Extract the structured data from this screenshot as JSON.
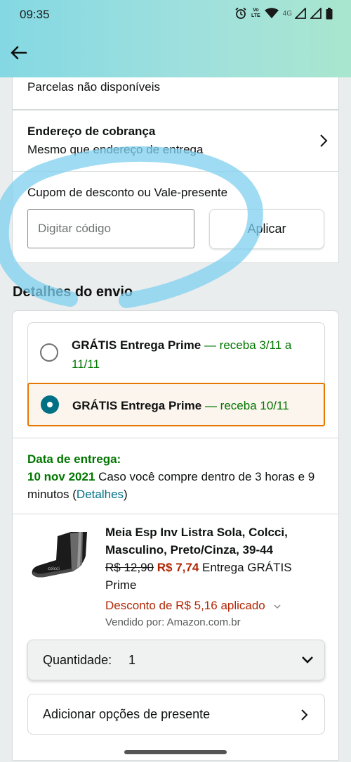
{
  "status": {
    "time": "09:35",
    "volte_line1": "Vo",
    "volte_line2": "LTE",
    "network": "4G"
  },
  "payment": {
    "installments": "Parcelas não disponíveis"
  },
  "billing": {
    "title": "Endereço de cobrança",
    "value": "Mesmo que endereço de entrega"
  },
  "coupon": {
    "label": "Cupom de desconto ou Vale-presente",
    "placeholder": "Digitar código",
    "apply": "Aplicar"
  },
  "shipping": {
    "title": "Detalhes do envio",
    "options": [
      {
        "name": "GRÁTIS Entrega Prime",
        "sep": " — ",
        "date": "receba 3/11 a 11/11",
        "selected": false
      },
      {
        "name": "GRÁTIS Entrega Prime",
        "sep": " — ",
        "date": "receba 10/11",
        "selected": true
      }
    ],
    "delivery_label": "Data de entrega:",
    "delivery_date": "10 nov 2021",
    "delivery_condition": " Caso você compre dentro de 3 horas e 9 minutos (",
    "details_link": "Detalhes",
    "close_paren": ")"
  },
  "product": {
    "name": "Meia Esp Inv Listra Sola, Colcci, Masculino, Preto/Cinza, 39-44",
    "old_price": "R$ 12,90",
    "price": "R$ 7,74",
    "shipping": " Entrega GRÁTIS Prime",
    "discount": "Desconto de R$ 5,16 aplicado",
    "seller": "Vendido por: Amazon.com.br",
    "quantity_label": "Quantidade:",
    "quantity_value": "1",
    "gift": "Adicionar opções de presente"
  },
  "colors": {
    "accent_teal": "#007185",
    "selected_border": "#e77600",
    "green": "#007600",
    "red": "#b12704",
    "annotation": "#7fd0f0"
  }
}
